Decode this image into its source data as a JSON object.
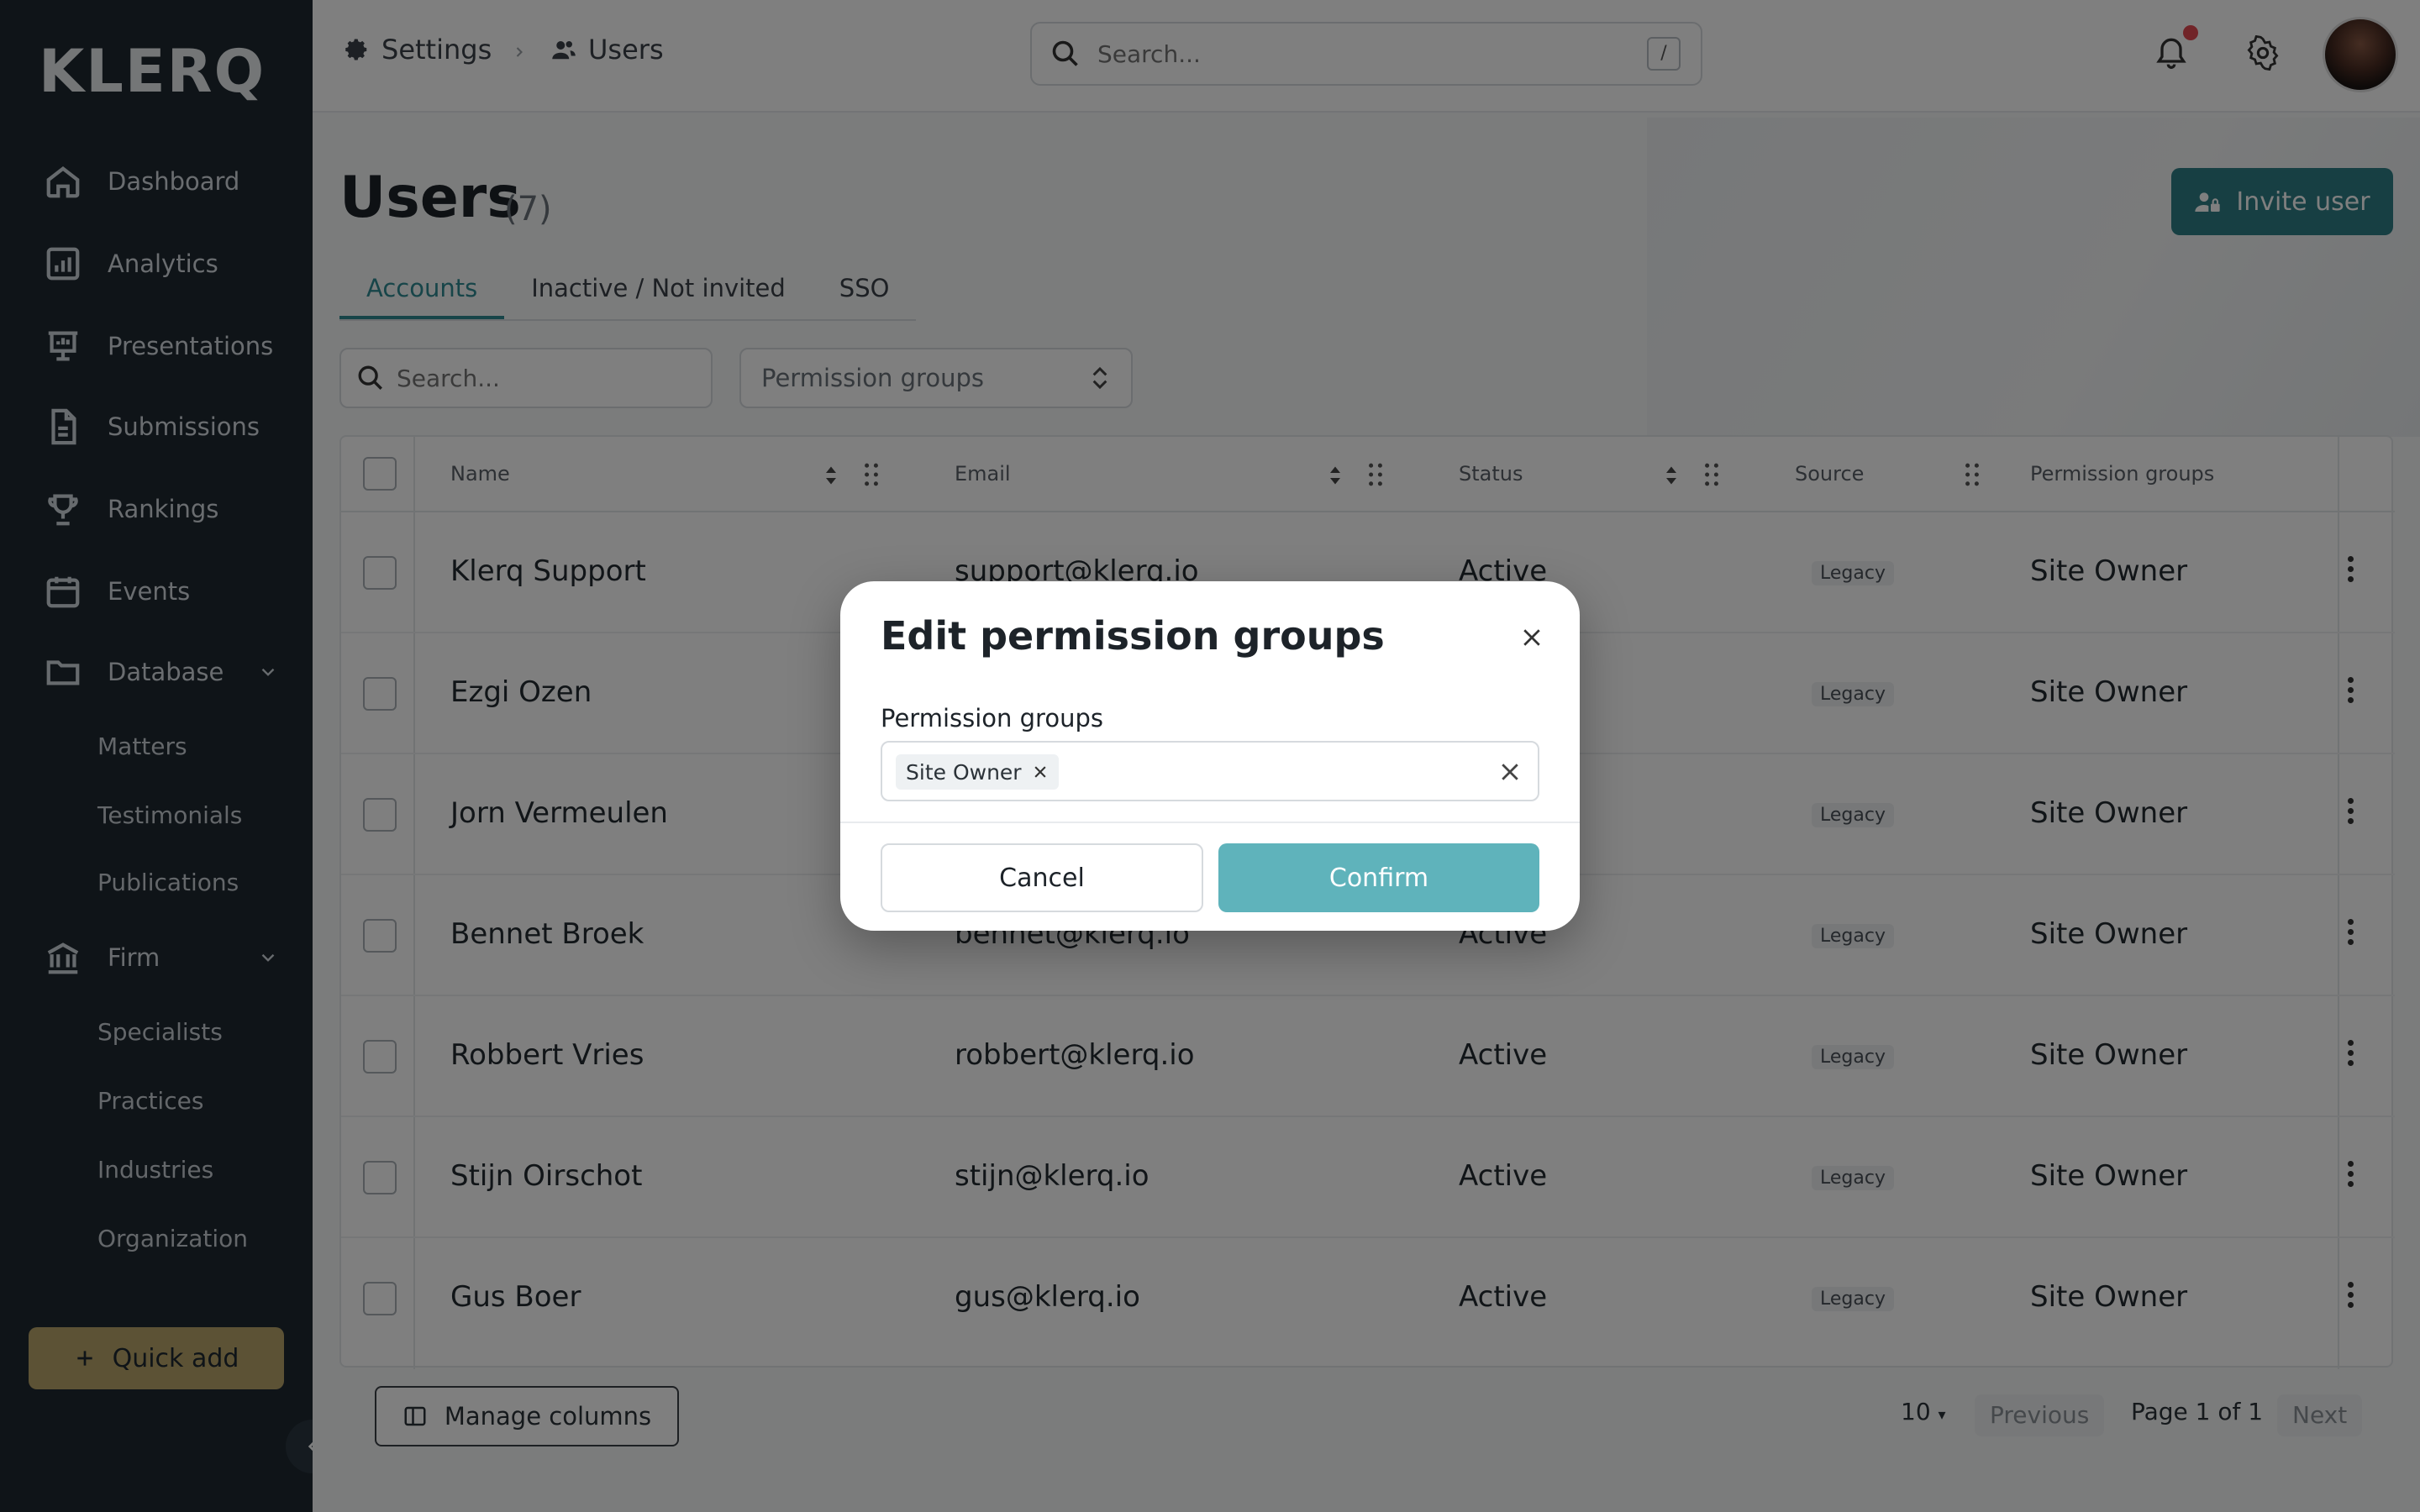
{
  "sidebar": {
    "logo": "KLERQ",
    "items": [
      {
        "label": "Dashboard",
        "icon": "home-icon"
      },
      {
        "label": "Analytics",
        "icon": "bar-chart-icon"
      },
      {
        "label": "Presentations",
        "icon": "presentation-icon"
      },
      {
        "label": "Submissions",
        "icon": "document-icon"
      },
      {
        "label": "Rankings",
        "icon": "trophy-icon"
      },
      {
        "label": "Events",
        "icon": "calendar-icon"
      },
      {
        "label": "Database",
        "icon": "folder-icon"
      },
      {
        "label": "Firm",
        "icon": "bank-icon"
      }
    ],
    "database_sub": [
      "Matters",
      "Testimonials",
      "Publications"
    ],
    "firm_sub": [
      "Specialists",
      "Practices",
      "Industries",
      "Organization"
    ],
    "quick_add": "Quick add"
  },
  "topbar": {
    "breadcrumb": [
      "Settings",
      "Users"
    ],
    "search_placeholder": "Search...",
    "search_shortcut": "/"
  },
  "page": {
    "title": "Users",
    "count": "(7)",
    "invite_label": "Invite user",
    "tabs": [
      "Accounts",
      "Inactive / Not invited",
      "SSO"
    ],
    "filter_search_placeholder": "Search...",
    "permission_filter": "Permission groups"
  },
  "table": {
    "headers": [
      "Name",
      "Email",
      "Status",
      "Source",
      "Permission groups"
    ],
    "rows": [
      {
        "name": "Klerq Support",
        "email": "support@klerq.io",
        "status": "Active",
        "source": "Legacy",
        "group": "Site Owner"
      },
      {
        "name": "Ezgi Ozen",
        "email": "",
        "status": "",
        "source": "Legacy",
        "group": "Site Owner"
      },
      {
        "name": "Jorn Vermeulen",
        "email": "",
        "status": "",
        "source": "Legacy",
        "group": "Site Owner"
      },
      {
        "name": "Bennet Broek",
        "email": "bennet@klerq.io",
        "status": "Active",
        "source": "Legacy",
        "group": "Site Owner"
      },
      {
        "name": "Robbert Vries",
        "email": "robbert@klerq.io",
        "status": "Active",
        "source": "Legacy",
        "group": "Site Owner"
      },
      {
        "name": "Stijn Oirschot",
        "email": "stijn@klerq.io",
        "status": "Active",
        "source": "Legacy",
        "group": "Site Owner"
      },
      {
        "name": "Gus Boer",
        "email": "gus@klerq.io",
        "status": "Active",
        "source": "Legacy",
        "group": "Site Owner"
      }
    ],
    "manage_columns": "Manage columns",
    "page_size": "10",
    "previous": "Previous",
    "page_info": "Page 1 of 1",
    "next": "Next"
  },
  "modal": {
    "title": "Edit permission groups",
    "field_label": "Permission groups",
    "selected_tag": "Site Owner",
    "cancel": "Cancel",
    "confirm": "Confirm"
  },
  "colors": {
    "sidebar_bg": "#1e2830",
    "accent": "#2f7f86",
    "confirm": "#5fb3bb",
    "quick_add": "#b8a46a"
  }
}
